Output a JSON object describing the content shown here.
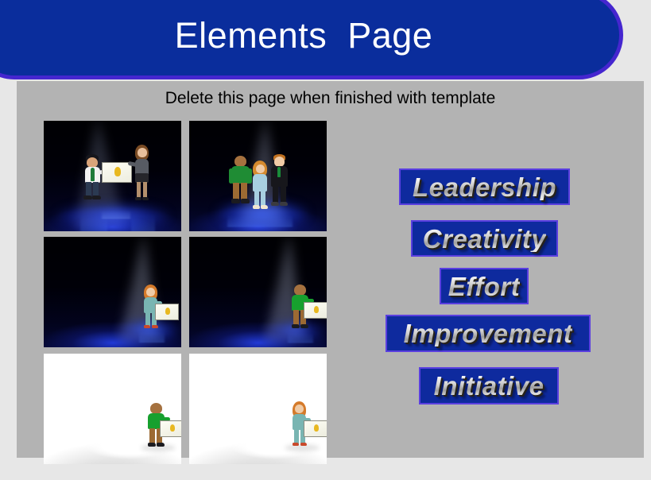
{
  "slide": {
    "title": "Elements  Page",
    "subtitle": "Delete this page when finished with template",
    "background_color": "#e7e7e7",
    "panel_color": "#b3b3b3"
  },
  "theme": {
    "banner_fill": "#0a2d9c",
    "banner_border": "#4526cf",
    "title_color": "#ffffff",
    "wordart_fill": "#0e2a9e",
    "wordart_border": "#5a3fe0",
    "wordart_text_gradient": "#cfcfcf"
  },
  "wordart": [
    {
      "label": "Leadership"
    },
    {
      "label": "Creativity"
    },
    {
      "label": "Effort"
    },
    {
      "label": "Improvement"
    },
    {
      "label": "Initiative"
    }
  ],
  "images": [
    {
      "name": "award-presentation-dark",
      "alt": "Man receiving certificate from woman on dark stage with blue spotlight"
    },
    {
      "name": "team-trio-spotlight-dark",
      "alt": "Three colleagues standing together under a spotlight on dark stage"
    },
    {
      "name": "woman-certificate-dark",
      "alt": "Woman in teal suit holding certificate under spotlight on dark stage"
    },
    {
      "name": "man-certificate-dark",
      "alt": "Man in green shirt holding certificate under spotlight on dark stage"
    },
    {
      "name": "man-certificate-white",
      "alt": "Man in green shirt holding certificate on white background"
    },
    {
      "name": "woman-certificate-white",
      "alt": "Woman in teal suit holding certificate on white background"
    }
  ]
}
